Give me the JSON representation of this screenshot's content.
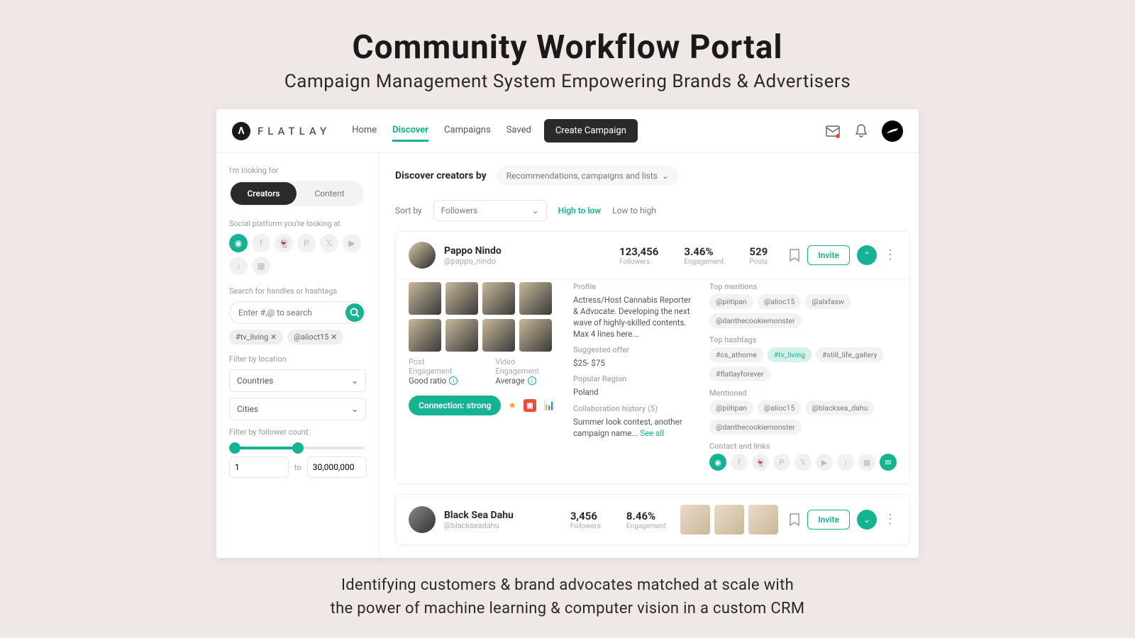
{
  "hero": {
    "title": "Community Workflow Portal",
    "subtitle": "Campaign Management System Empowering Brands & Advertisers"
  },
  "brand": "FLATLAY",
  "nav": {
    "home": "Home",
    "discover": "Discover",
    "campaigns": "Campaigns",
    "saved": "Saved"
  },
  "create_btn": "Create Campaign",
  "sidebar": {
    "looking_label": "I'm looking for",
    "tab_creators": "Creators",
    "tab_content": "Content",
    "platform_label": "Social platform you're looking at",
    "search_label": "Search for handles or hashtags",
    "search_placeholder": "Enter #,@ to search",
    "chips": [
      "#tv_living ✕",
      "@alioct15 ✕"
    ],
    "location_label": "Filter by location",
    "countries": "Countries",
    "cities": "Cities",
    "followers_label": "Filter by follower count",
    "range_from": "1",
    "range_to_word": "to",
    "range_to": "30,000,000"
  },
  "main": {
    "discover_label": "Discover creators by",
    "discover_drop": "Recommendations, campaigns and lists",
    "sort_label": "Sort by",
    "sort_sel": "Followers",
    "sort_high": "High to low",
    "sort_low": "Low to high"
  },
  "creator1": {
    "name": "Pappo Nindo",
    "handle": "@pappo_nindo",
    "followers_v": "123,456",
    "followers_l": "Followers",
    "engagement_v": "3.46%",
    "engagement_l": "Engagement",
    "posts_v": "529",
    "posts_l": "Posts",
    "invite": "Invite",
    "post_eng_l": "Post Engagement",
    "post_eng_v": "Good ratio",
    "video_eng_l": "Video Engagement",
    "video_eng_v": "Average",
    "connection": "Connection: strong",
    "profile_h": "Profile",
    "profile_t": "Actress/Host Cannabis Reporter & Advocate. Developing the next wave of highly-skilled contents. Max 4 lines here...",
    "offer_h": "Suggested offer",
    "offer_v": "$25- $75",
    "region_h": "Popular Region",
    "region_v": "Poland",
    "collab_h": "Collaboration history (5)",
    "collab_t": "Summer look contest, another campaign name... ",
    "see_all": "See all",
    "mentions_h": "Top mentions",
    "mentions": [
      "@piitipan",
      "@alioc15",
      "@alxfasw",
      "@danthecookiemonster"
    ],
    "hashtags_h": "Top hashtags",
    "hashtags": [
      "#cs_athome",
      "#tv_living",
      "#still_life_gallery",
      "#flatlayforever"
    ],
    "mentioned_h": "Mentioned",
    "mentioned": [
      "@piitipan",
      "@alioc15",
      "@blacksea_dahu",
      "@danthecookiemonster"
    ],
    "contact_h": "Contact and links"
  },
  "creator2": {
    "name": "Black Sea Dahu",
    "handle": "@blackseadahu",
    "followers_v": "3,456",
    "followers_l": "Followers",
    "engagement_v": "8.46%",
    "engagement_l": "Engagement",
    "invite": "Invite"
  },
  "footer_l1": "Identifying  customers & brand advocates matched at scale with",
  "footer_l2": "the power of machine learning & computer vision in a custom CRM"
}
